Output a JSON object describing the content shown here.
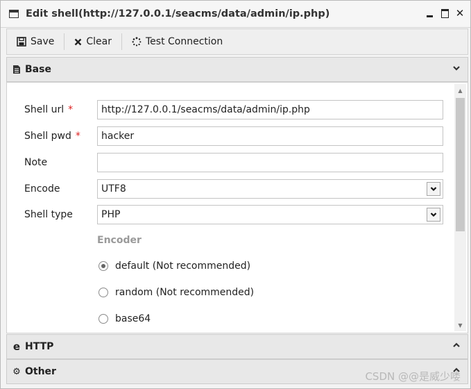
{
  "window": {
    "title": "Edit shell(http://127.0.0.1/seacms/data/admin/ip.php)",
    "controls": {
      "minimize": "minimize",
      "maximize": "maximize",
      "close": "✕"
    }
  },
  "toolbar": {
    "save_label": "Save",
    "clear_label": "Clear",
    "test_label": "Test Connection"
  },
  "sections": {
    "base": "Base",
    "http": "HTTP",
    "other": "Other"
  },
  "form": {
    "shell_url_label": "Shell url",
    "shell_url_value": "http://127.0.0.1/seacms/data/admin/ip.php",
    "shell_pwd_label": "Shell pwd",
    "shell_pwd_value": "hacker",
    "note_label": "Note",
    "note_value": "",
    "encode_label": "Encode",
    "encode_value": "UTF8",
    "shell_type_label": "Shell type",
    "shell_type_value": "PHP",
    "required_mark": "*",
    "encoder_label": "Encoder",
    "encoder_options": [
      {
        "label": "default (Not recommended)",
        "selected": true
      },
      {
        "label": "random (Not recommended)",
        "selected": false
      },
      {
        "label": "base64",
        "selected": false
      }
    ]
  },
  "watermark": "CSDN @@是威少喽",
  "icons": {
    "window": "window-icon",
    "save": "floppy-icon",
    "clear": "close-icon",
    "test": "spinner-icon",
    "base": "document-icon",
    "http": "edge-icon",
    "other": "gears-icon",
    "chevron_down": "chevron-down-icon",
    "chevron_up": "chevron-up-icon"
  }
}
